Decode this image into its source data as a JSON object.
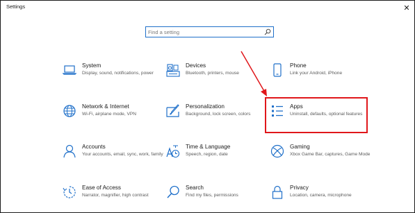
{
  "window": {
    "title": "Settings",
    "close_glyph": "✕"
  },
  "search": {
    "placeholder": "Find a setting",
    "value": ""
  },
  "tiles": [
    {
      "id": "system",
      "label": "System",
      "desc": "Display, sound, notifications, power",
      "icon": "laptop-icon"
    },
    {
      "id": "devices",
      "label": "Devices",
      "desc": "Bluetooth, printers, mouse",
      "icon": "keyboard-speaker-icon"
    },
    {
      "id": "phone",
      "label": "Phone",
      "desc": "Link your Android, iPhone",
      "icon": "phone-icon"
    },
    {
      "id": "network",
      "label": "Network & Internet",
      "desc": "Wi-Fi, airplane mode, VPN",
      "icon": "globe-icon"
    },
    {
      "id": "personalization",
      "label": "Personalization",
      "desc": "Background, lock screen, colors",
      "icon": "paint-icon"
    },
    {
      "id": "apps",
      "label": "Apps",
      "desc": "Uninstall, defaults, optional features",
      "icon": "apps-list-icon"
    },
    {
      "id": "accounts",
      "label": "Accounts",
      "desc": "Your accounts, email, sync, work, family",
      "icon": "person-icon"
    },
    {
      "id": "time-language",
      "label": "Time & Language",
      "desc": "Speech, region, date",
      "icon": "time-language-icon"
    },
    {
      "id": "gaming",
      "label": "Gaming",
      "desc": "Xbox Game Bar, captures, Game Mode",
      "icon": "xbox-icon"
    },
    {
      "id": "ease-of-access",
      "label": "Ease of Access",
      "desc": "Narrator, magnifier, high contrast",
      "icon": "ease-of-access-icon"
    },
    {
      "id": "search",
      "label": "Search",
      "desc": "Find my files, permissions",
      "icon": "magnifier-icon"
    },
    {
      "id": "privacy",
      "label": "Privacy",
      "desc": "Location, camera, microphone",
      "icon": "lock-icon"
    }
  ],
  "annotation": {
    "highlight_target": "apps",
    "highlight_color": "#e0161a",
    "arrow_color": "#e0161a"
  },
  "colors": {
    "accent": "#1e6fc9",
    "icon": "#1e6fc9"
  }
}
